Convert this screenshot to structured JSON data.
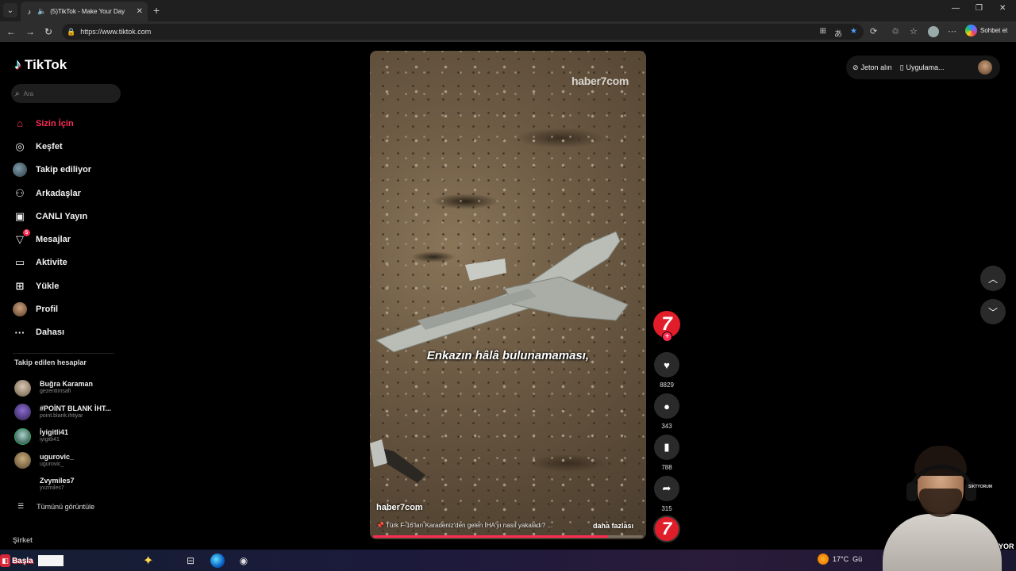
{
  "browser": {
    "tab_title": "(5)TikTok - Make Your Day",
    "url": "https://www.tiktok.com",
    "copilot_label": "Sohbet et"
  },
  "sidebar": {
    "brand": "TikTok",
    "search_placeholder": "Ara",
    "nav": [
      {
        "label": "Sizin İçin",
        "icon": "home-icon",
        "active": true
      },
      {
        "label": "Keşfet",
        "icon": "compass-icon"
      },
      {
        "label": "Takip ediliyor",
        "icon": "following-avatar"
      },
      {
        "label": "Arkadaşlar",
        "icon": "friends-icon"
      },
      {
        "label": "CANLI Yayın",
        "icon": "live-icon"
      },
      {
        "label": "Mesajlar",
        "icon": "messages-icon",
        "badge": "5"
      },
      {
        "label": "Aktivite",
        "icon": "activity-icon"
      },
      {
        "label": "Yükle",
        "icon": "upload-icon"
      },
      {
        "label": "Profil",
        "icon": "profile-avatar"
      },
      {
        "label": "Dahası",
        "icon": "more-icon"
      }
    ],
    "following_title": "Takip edilen hesaplar",
    "following": [
      {
        "name": "Buğra Karaman",
        "handle": "gezentimsafi"
      },
      {
        "name": "#POİNT BLANK İHT...",
        "handle": "point.blank.ihtiyar"
      },
      {
        "name": "İyigitli41",
        "handle": "iyigitli41"
      },
      {
        "name": "ugurovic_",
        "handle": "ugurovic_"
      },
      {
        "name": "Zvymiles7",
        "handle": "yvzmiles7"
      }
    ],
    "see_all": "Tümünü görüntüle",
    "company": "Şirket"
  },
  "video": {
    "watermark": "haber7com",
    "caption_overlay": "Enkazın hâlâ bulunamaması,",
    "author": "haber7com",
    "description": "📌 Türk F-16'ları Karadeniz'den gelen İHA'yı nasıl yakaladı? ...",
    "more_label": "daha fazlası",
    "progress": 0.87
  },
  "actions": {
    "creator_logo": "7",
    "likes": "8829",
    "comments": "343",
    "saves": "788",
    "shares": "315"
  },
  "top_right": {
    "coins": "Jeton alın",
    "app": "Uygulama..."
  },
  "taskbar": {
    "start_label": "Başla",
    "weather_temp": "17°C",
    "weather_text": "Gü"
  },
  "webcam": {
    "headset_text": "SIKTYORUM",
    "side_text": "YOR"
  },
  "colors": {
    "accent": "#fe2c55",
    "haber7_red": "#e11d2a"
  }
}
